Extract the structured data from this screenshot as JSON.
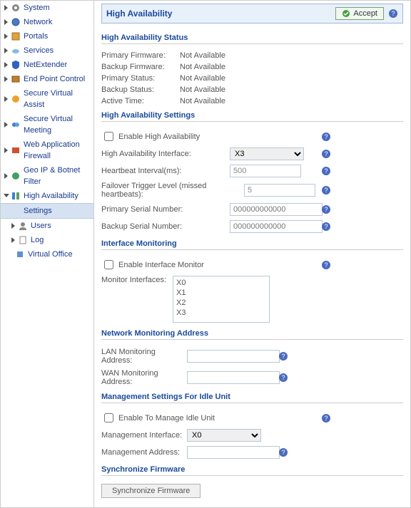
{
  "sidebar": {
    "items": [
      {
        "label": "System"
      },
      {
        "label": "Network"
      },
      {
        "label": "Portals"
      },
      {
        "label": "Services"
      },
      {
        "label": "NetExtender"
      },
      {
        "label": "End Point Control"
      },
      {
        "label": "Secure Virtual Assist"
      },
      {
        "label": "Secure Virtual Meeting"
      },
      {
        "label": "Web Application Firewall"
      },
      {
        "label": "Geo IP & Botnet Filter"
      },
      {
        "label": "High Availability"
      },
      {
        "label": "Settings"
      },
      {
        "label": "Users"
      },
      {
        "label": "Log"
      },
      {
        "label": "Virtual Office"
      }
    ]
  },
  "header": {
    "title": "High Availability",
    "accept_label": "Accept"
  },
  "status": {
    "heading": "High Availability Status",
    "rows": [
      {
        "label": "Primary Firmware:",
        "value": "Not Available"
      },
      {
        "label": "Backup Firmware:",
        "value": "Not Available"
      },
      {
        "label": "Primary Status:",
        "value": "Not Available"
      },
      {
        "label": "Backup Status:",
        "value": "Not Available"
      },
      {
        "label": "Active Time:",
        "value": "Not Available"
      }
    ]
  },
  "settings": {
    "heading": "High Availability Settings",
    "enable_label": "Enable High Availability",
    "interface_label": "High Availability Interface:",
    "interface_value": "X3",
    "hb_label": "Heartbeat Interval(ms):",
    "hb_value": "500",
    "failover_label": "Failover Trigger Level (missed heartbeats):",
    "failover_value": "5",
    "primary_sn_label": "Primary Serial Number:",
    "primary_sn_placeholder": "000000000000",
    "backup_sn_label": "Backup Serial Number:",
    "backup_sn_placeholder": "000000000000"
  },
  "monitoring": {
    "heading": "Interface Monitoring",
    "enable_label": "Enable Interface Monitor",
    "list_label": "Monitor Interfaces:",
    "options": [
      "X0",
      "X1",
      "X2",
      "X3"
    ]
  },
  "netmon": {
    "heading": "Network Monitoring Address",
    "lan_label": "LAN Monitoring Address:",
    "wan_label": "WAN Monitoring Address:"
  },
  "idle": {
    "heading": "Management Settings For Idle Unit",
    "enable_label": "Enable To Manage Idle Unit",
    "interface_label": "Management Interface:",
    "interface_value": "X0",
    "address_label": "Management Address:"
  },
  "sync": {
    "heading": "Synchronize Firmware",
    "button_label": "Synchronize Firmware"
  }
}
